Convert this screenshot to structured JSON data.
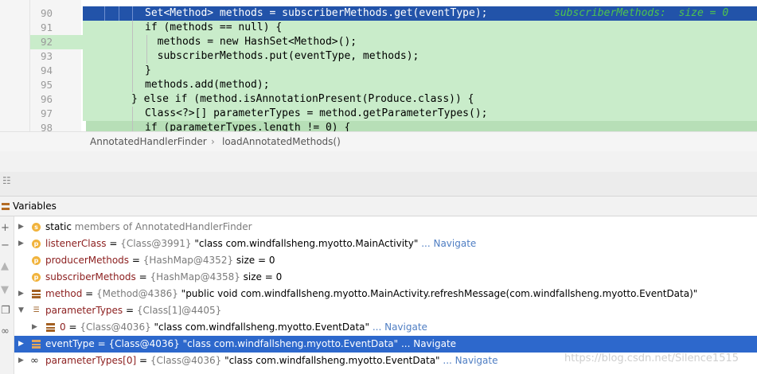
{
  "editor": {
    "lines": [
      {
        "num": "90",
        "code": "Set<Method> methods = subscriberMethods.get(eventType);",
        "inline": "subscriberMethods:  size = 0",
        "exec": true
      },
      {
        "num": "91",
        "code": "if (methods == null) {"
      },
      {
        "num": "92",
        "code": "  methods = new HashSet<Method>();"
      },
      {
        "num": "93",
        "code": "  subscriberMethods.put(eventType, methods);"
      },
      {
        "num": "94",
        "code": "}"
      },
      {
        "num": "95",
        "code": "methods.add(method);"
      },
      {
        "num": "96",
        "code": "} else if (method.isAnnotationPresent(Produce.class)) {"
      },
      {
        "num": "97",
        "code": "Class<?>[] parameterTypes = method.getParameterTypes();"
      },
      {
        "num": "98",
        "code": "if (parameterTypes.length != 0) {"
      }
    ]
  },
  "breadcrumb": {
    "class_name": "AnnotatedHandlerFinder",
    "separator": "›",
    "method_name": "loadAnnotatedMethods()"
  },
  "variables_panel": {
    "title": "Variables",
    "rows": [
      {
        "icon": "static-icon",
        "name": "static",
        "value": "members of AnnotatedHandlerFinder"
      },
      {
        "icon": "field-icon",
        "name": "listenerClass",
        "eq": " = ",
        "ref": "{Class@3991}",
        "value": " \"class com.windfallsheng.myotto.MainActivity\"",
        "nav": " ... Navigate"
      },
      {
        "icon": "field-icon",
        "name": "producerMethods",
        "eq": " = ",
        "ref": "{HashMap@4352}",
        "value": "  size = 0"
      },
      {
        "icon": "field-icon",
        "name": "subscriberMethods",
        "eq": " = ",
        "ref": "{HashMap@4358}",
        "value": "  size = 0"
      },
      {
        "icon": "local-variable-icon",
        "name": "method",
        "eq": " = ",
        "ref": "{Method@4386}",
        "value": " \"public void com.windfallsheng.myotto.MainActivity.refreshMessage(com.windfallsheng.myotto.EventData)\""
      },
      {
        "icon": "array-icon",
        "name": "parameterTypes",
        "eq": " = ",
        "ref": "{Class[1]@4405}"
      },
      {
        "icon": "local-variable-icon",
        "name": "0",
        "eq": " = ",
        "ref": "{Class@4036}",
        "value": " \"class com.windfallsheng.myotto.EventData\"",
        "nav": " ... Navigate"
      },
      {
        "icon": "local-variable-icon",
        "name": "eventType",
        "eq": " = ",
        "ref": "{Class@4036}",
        "value": " \"class com.windfallsheng.myotto.EventData\"",
        "nav": " ... Navigate",
        "selected": true
      },
      {
        "icon": "watch-icon",
        "name": "parameterTypes[0]",
        "eq": " = ",
        "ref": "{Class@4036}",
        "value": " \"class com.windfallsheng.myotto.EventData\"",
        "nav": " ... Navigate"
      }
    ]
  },
  "colors": {
    "execution_line": "#2253a9",
    "covered_line": "#c9ecca",
    "selected_row": "#2d68cc",
    "inline_value": "#4ec44e"
  },
  "watermark": "https://blog.csdn.net/Silence1515"
}
